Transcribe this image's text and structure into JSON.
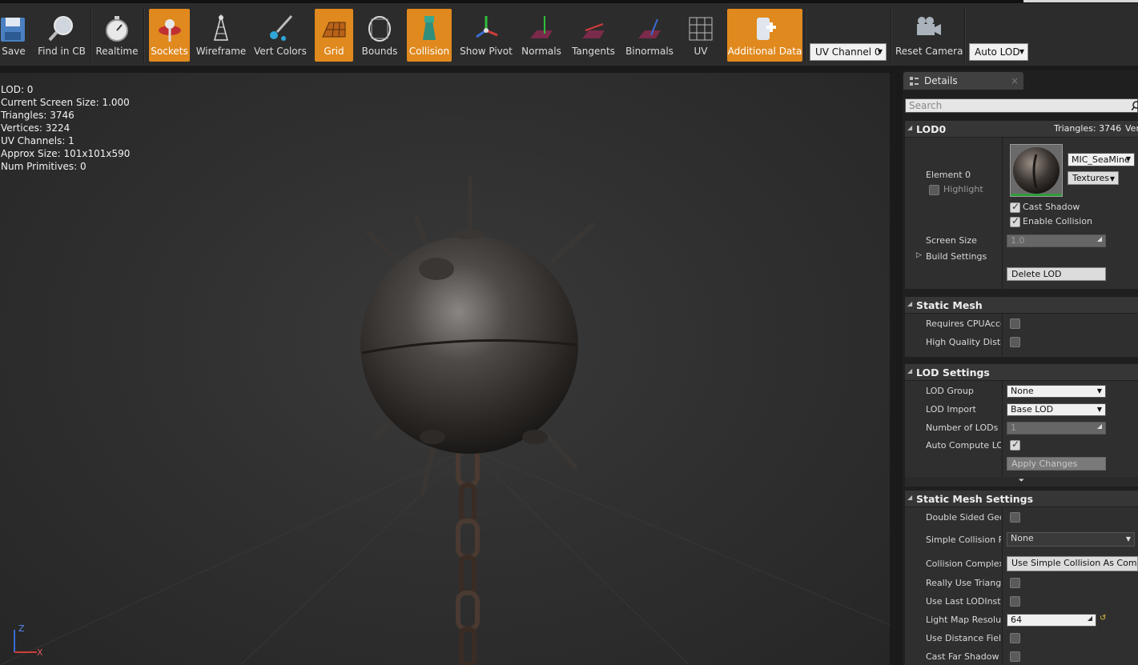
{
  "toolbar": {
    "buttons": [
      {
        "label": "Save",
        "active": false
      },
      {
        "label": "Find in CB",
        "active": false
      },
      {
        "label": "Realtime",
        "active": false
      },
      {
        "label": "Sockets",
        "active": true
      },
      {
        "label": "Wireframe",
        "active": false
      },
      {
        "label": "Vert Colors",
        "active": false
      },
      {
        "label": "Grid",
        "active": true
      },
      {
        "label": "Bounds",
        "active": false
      },
      {
        "label": "Collision",
        "active": true
      },
      {
        "label": "Show Pivot",
        "active": false
      },
      {
        "label": "Normals",
        "active": false
      },
      {
        "label": "Tangents",
        "active": false
      },
      {
        "label": "Binormals",
        "active": false
      },
      {
        "label": "UV",
        "active": false
      },
      {
        "label": "Additional Data",
        "active": true
      },
      {
        "label": "Reset Camera",
        "active": false
      }
    ],
    "uv_channel": "UV Channel 0",
    "auto_lod": "Auto LOD",
    "accent_color": "#e0891e"
  },
  "viewport": {
    "stats": [
      "LOD:  0",
      "Current Screen Size:  1.000",
      "Triangles:  3746",
      "Vertices:  3224",
      "UV Channels:  1",
      "Approx Size:  101x101x590",
      "Num Primitives:  0"
    ],
    "axis": {
      "z": "Z",
      "x": "X"
    }
  },
  "details": {
    "tab_label": "Details",
    "search_placeholder": "Search",
    "lod0": {
      "title": "LOD0",
      "triangles": "Triangles: 3746",
      "vertices_trunc": "Ver",
      "element_label": "Element 0",
      "highlight_label": "Highlight",
      "material_name": "MIC_SeaMine",
      "textures_label": "Textures",
      "cast_shadow_label": "Cast Shadow",
      "enable_collision_label": "Enable Collision",
      "screen_size_label": "Screen Size",
      "screen_size_value": "1.0",
      "build_settings_label": "Build Settings",
      "delete_lod_label": "Delete LOD"
    },
    "static_mesh": {
      "title": "Static Mesh",
      "requires_cpu": "Requires CPUAcces",
      "high_quality": "High Quality Distar"
    },
    "lod_settings": {
      "title": "LOD Settings",
      "lod_group_label": "LOD Group",
      "lod_group_value": "None",
      "lod_import_label": "LOD Import",
      "lod_import_value": "Base LOD",
      "num_lods_label": "Number of LODs",
      "num_lods_value": "1",
      "auto_compute_label": "Auto Compute LOD",
      "apply_changes_label": "Apply Changes"
    },
    "static_mesh_settings": {
      "title": "Static Mesh Settings",
      "double_sided": "Double Sided Geom",
      "simple_collision_label": "Simple Collision Ph",
      "simple_collision_value": "None",
      "collision_complexity_label": "Collision Complexit",
      "collision_complexity_value": "Use Simple Collision As Comple",
      "really_use": "Really Use Triangle",
      "use_last_lod": "Use Last LODInsteа",
      "light_map_label": "Light Map Resoluti",
      "light_map_value": "64",
      "use_distance": "Use Distance Field",
      "cast_far_shadow": "Cast Far Shadow"
    }
  }
}
